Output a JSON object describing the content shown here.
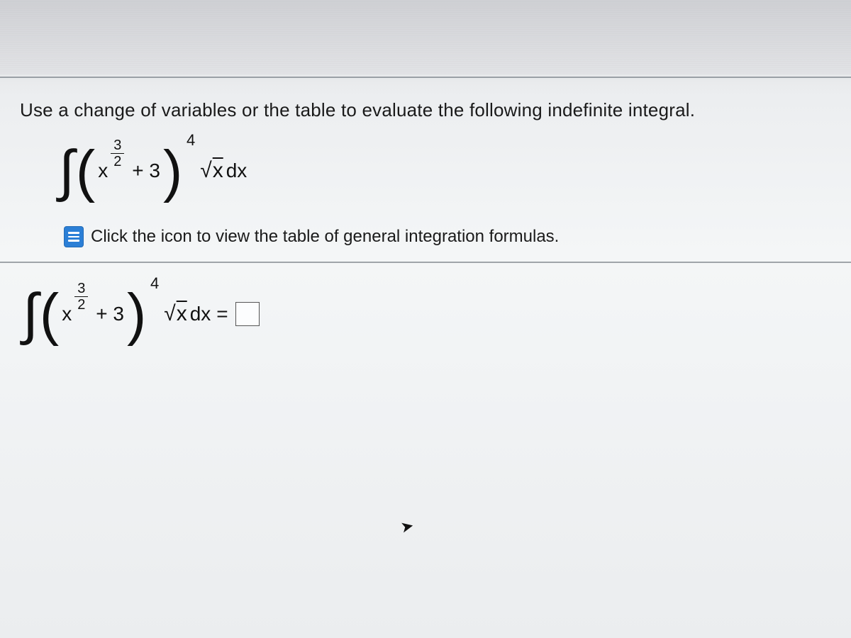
{
  "question": {
    "prompt": "Use a change of variables or the table to evaluate the following indefinite integral.",
    "hint": "Click the icon to view the table of general integration formulas."
  },
  "integral": {
    "variable": "x",
    "exponent_num": "3",
    "exponent_den": "2",
    "constant_term": "+ 3",
    "outer_power": "4",
    "radicand": "x",
    "differential": "dx"
  },
  "answer": {
    "equals": "=",
    "input_value": ""
  }
}
